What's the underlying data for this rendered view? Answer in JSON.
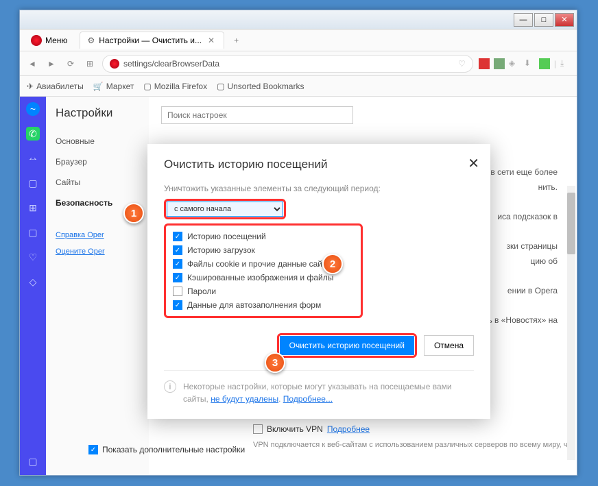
{
  "titlebar": {
    "min": "—",
    "max": "□",
    "close": "✕"
  },
  "menu_label": "Меню",
  "tab": {
    "title": "Настройки — Очистить и...",
    "close": "✕"
  },
  "newtab": "+",
  "nav": {
    "back": "◄",
    "fwd": "►",
    "reload": "⟳",
    "apps": "⊞"
  },
  "url": "settings/clearBrowserData",
  "bookmarks": [
    {
      "icon": "✈",
      "label": "Авиабилеты"
    },
    {
      "icon": "🛒",
      "label": "Маркет"
    },
    {
      "icon": "▢",
      "label": "Mozilla Firefox"
    },
    {
      "icon": "▢",
      "label": "Unsorted Bookmarks"
    }
  ],
  "settings": {
    "heading": "Настройки",
    "items": [
      "Основные",
      "Браузер",
      "Сайты",
      "Безопасность"
    ],
    "links": [
      "Справка Oper",
      "Оцените Oper"
    ],
    "search_placeholder": "Поиск настроек",
    "show_advanced": "Показать дополнительные настройки",
    "vpn_enable": "Включить VPN",
    "vpn_more": "Подробнее",
    "vpn_desc": "VPN подключается к веб-сайтам с использованием различных серверов по всему миру, что"
  },
  "dialog": {
    "title": "Очистить историю посещений",
    "label": "Уничтожить указанные элементы за следующий период:",
    "select": "с самого начала",
    "opts": [
      {
        "c": true,
        "t": "Историю посещений"
      },
      {
        "c": true,
        "t": "Историю загрузок"
      },
      {
        "c": true,
        "t": "Файлы cookie и прочие данные сайтов"
      },
      {
        "c": true,
        "t": "Кэшированные изображения и файлы"
      },
      {
        "c": false,
        "t": "Пароли"
      },
      {
        "c": true,
        "t": "Данные для автозаполнения форм"
      }
    ],
    "primary": "Очистить историю посещений",
    "cancel": "Отмена",
    "note_a": "Некоторые настройки, которые могут указывать на посещаемые вами сайты,",
    "note_link1": "не будут удалены",
    "note_sep": ". ",
    "note_link2": "Подробнее...",
    "close": "✕"
  },
  "markers": {
    "m1": "1",
    "m2": "2",
    "m3": "3"
  },
  "bg_lines": [
    "ь в сети еще более",
    "нить.",
    "иса подсказок в",
    "зки страницы",
    "цию об",
    "ении в Opera",
    "ть в «Новостях» на"
  ]
}
